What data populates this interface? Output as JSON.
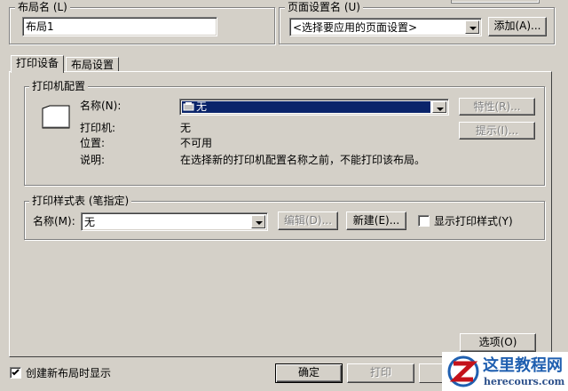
{
  "layout_name": {
    "label": "布局名 (L)",
    "value": "布局1"
  },
  "page_setup": {
    "label": "页面设置名 (U)",
    "selected": "<选择要应用的页面设置>",
    "add_button": "添加(A)..."
  },
  "tabs": [
    {
      "label": "打印设备"
    },
    {
      "label": "布局设置"
    }
  ],
  "printer_config": {
    "title": "打印机配置",
    "name_label": "名称(N):",
    "name_value": "无",
    "properties_button": "特性(R)...",
    "hints_button": "提示(I)...",
    "printer_label": "打印机:",
    "printer_value": "无",
    "location_label": "位置:",
    "location_value": "不可用",
    "description_label": "说明:",
    "description_value": "在选择新的打印机配置名称之前，不能打印该布局。"
  },
  "plot_style": {
    "title": "打印样式表 (笔指定)",
    "name_label": "名称(M):",
    "name_value": "无",
    "edit_button": "编辑(D)...",
    "new_button": "新建(E)...",
    "display_checkbox_label": "显示打印样式(Y)",
    "display_checked": false
  },
  "options_button": "选项(O)",
  "footer": {
    "create_checkbox_label": "创建新布局时显示",
    "create_checked": true,
    "ok_button": "确定",
    "print_button": "打印"
  },
  "watermark": {
    "title": "这里教程网",
    "url": "herecours.com"
  },
  "colors": {
    "face": "#d4d0c8",
    "selection": "#0a246a"
  }
}
